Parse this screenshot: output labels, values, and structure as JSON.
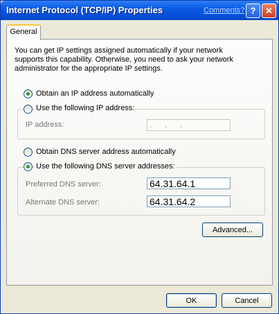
{
  "window": {
    "title": "Internet Protocol (TCP/IP) Properties",
    "comments_link": "Comments?",
    "help_glyph": "?",
    "close_glyph": "✕"
  },
  "tabs": [
    {
      "label": "General",
      "selected": true
    }
  ],
  "description": "You can get IP settings assigned automatically if your network supports this capability. Otherwise, you need to ask your network administrator for the appropriate IP settings.",
  "ip": {
    "auto_label": "Obtain an IP address automatically",
    "auto_selected": true,
    "manual_label": "Use the following IP address:",
    "manual_selected": false,
    "address_label": "IP address:",
    "address_value": ". . ."
  },
  "dns": {
    "auto_label": "Obtain DNS server address automatically",
    "auto_selected": false,
    "manual_label": "Use the following DNS server addresses:",
    "manual_selected": true,
    "preferred_label": "Preferred DNS server:",
    "preferred_value": "64.31.64.1",
    "alternate_label": "Alternate DNS server:",
    "alternate_value": "64.31.64.2"
  },
  "buttons": {
    "advanced": "Advanced...",
    "ok": "OK",
    "cancel": "Cancel"
  }
}
